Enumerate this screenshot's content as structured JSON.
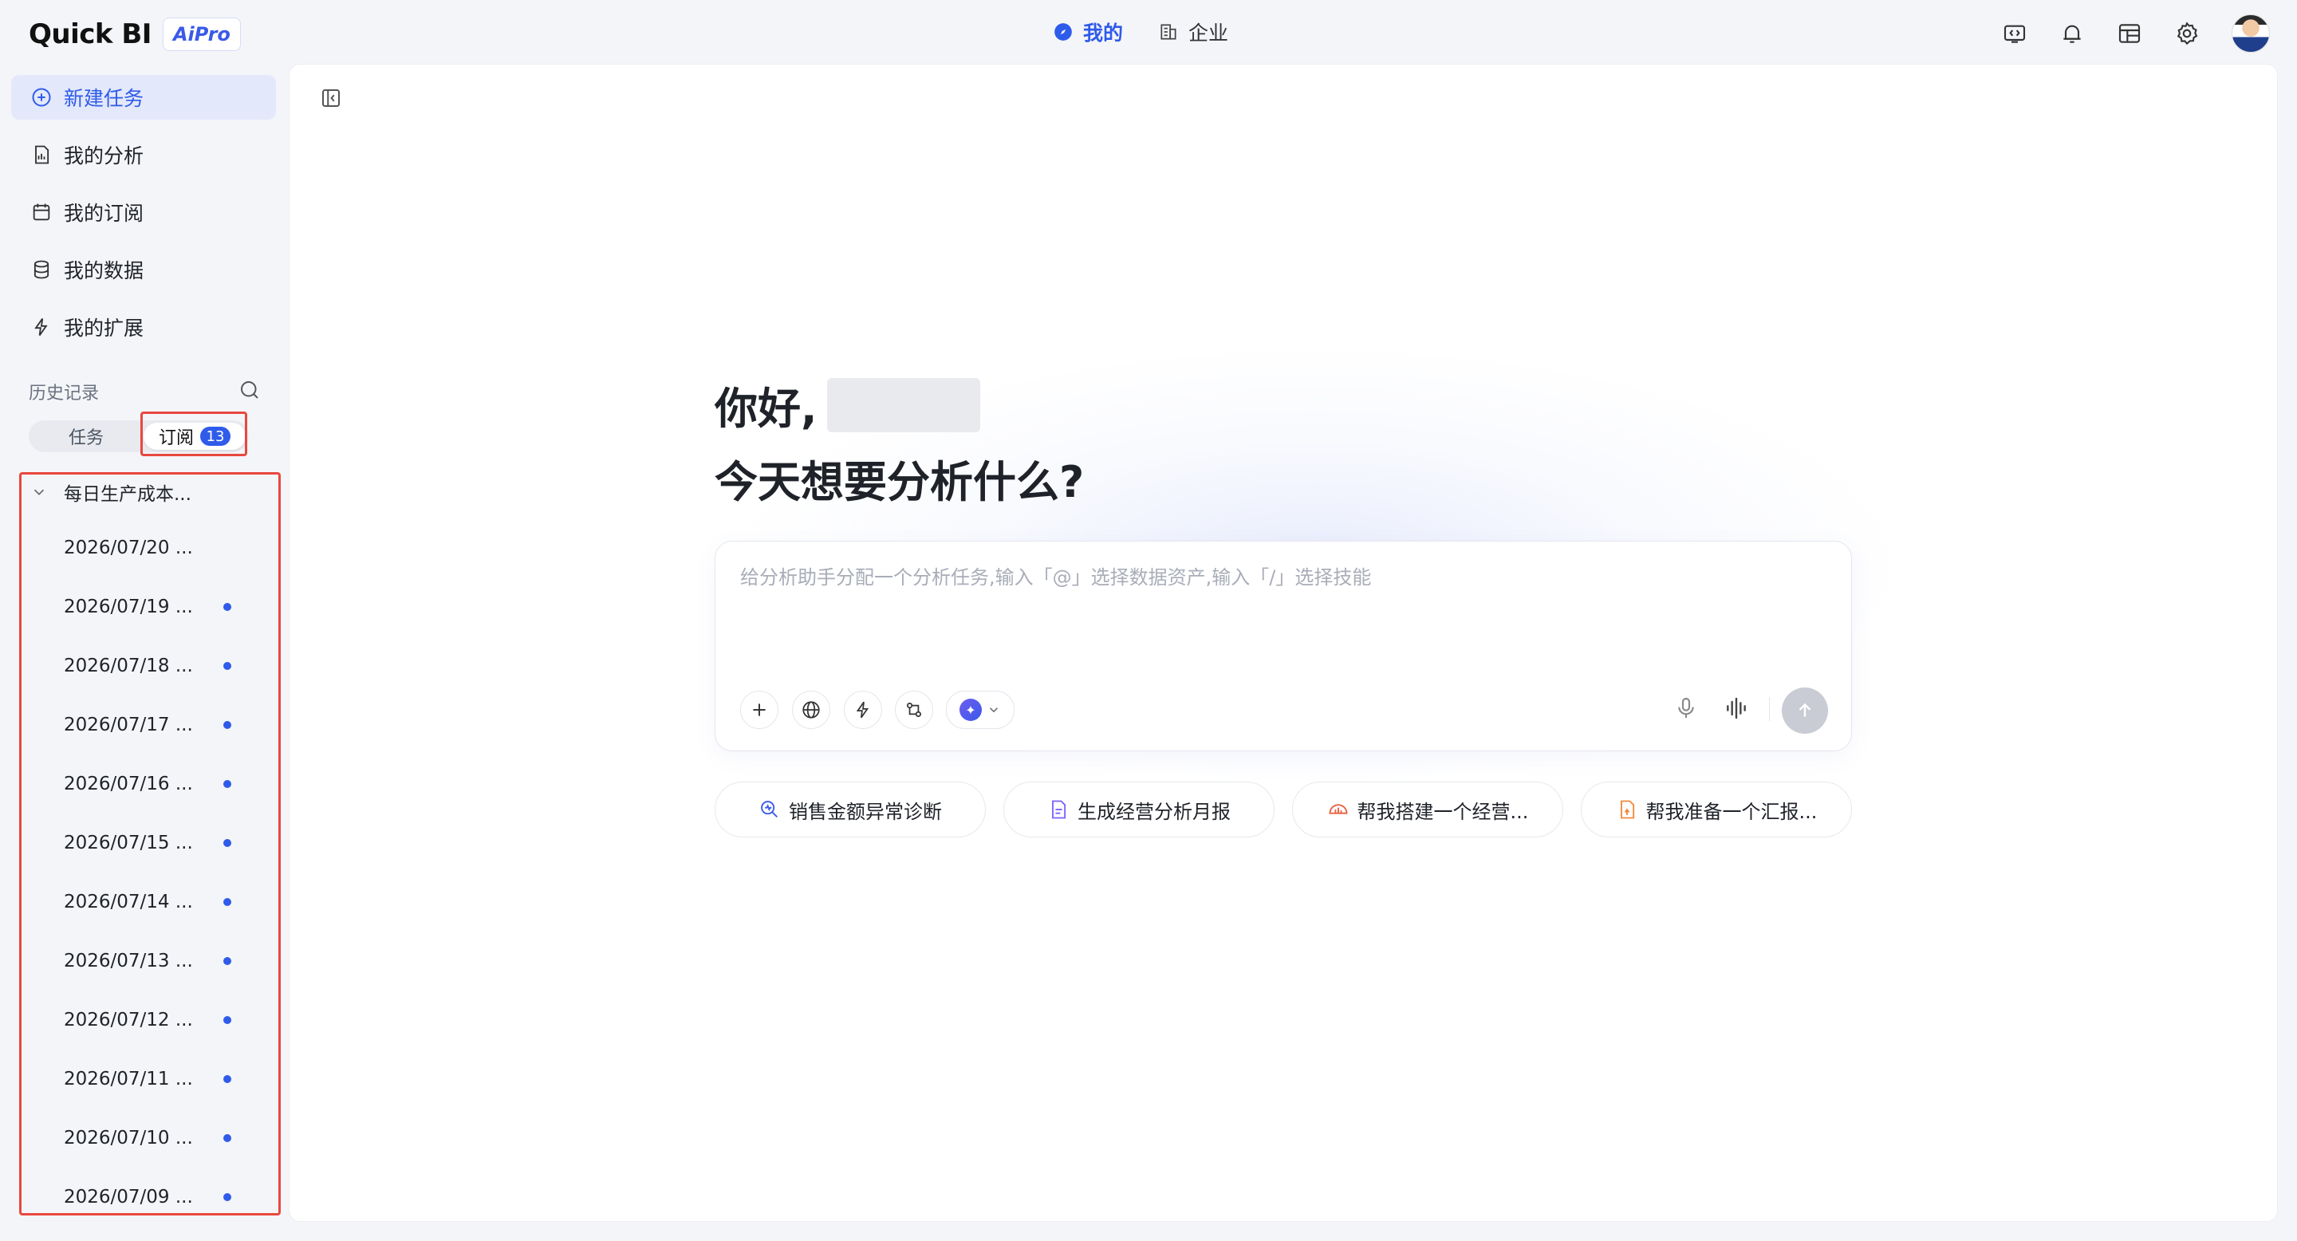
{
  "app": {
    "name": "Quick BI",
    "badge": "AiPro"
  },
  "topnav": [
    {
      "label": "我的",
      "icon": "compass-icon",
      "active": true
    },
    {
      "label": "企业",
      "icon": "building-icon",
      "active": false
    }
  ],
  "topright_icons": [
    "code-window-icon",
    "bell-icon",
    "dashboard-icon",
    "gear-icon",
    "user-avatar"
  ],
  "sidebar": {
    "items": [
      {
        "label": "新建任务",
        "icon": "plus-circle-icon",
        "active": true
      },
      {
        "label": "我的分析",
        "icon": "report-file-icon",
        "active": false
      },
      {
        "label": "我的订阅",
        "icon": "calendar-icon",
        "active": false
      },
      {
        "label": "我的数据",
        "icon": "database-icon",
        "active": false
      },
      {
        "label": "我的扩展",
        "icon": "lightning-icon",
        "active": false
      }
    ],
    "history_label": "历史记录",
    "tabs": {
      "task": "任务",
      "subscription": "订阅",
      "subscription_count": "13"
    },
    "group_title": "每日生产成本...",
    "subscriptions": [
      {
        "label": "2026/07/20 ...",
        "unread": false
      },
      {
        "label": "2026/07/19 ...",
        "unread": true
      },
      {
        "label": "2026/07/18 ...",
        "unread": true
      },
      {
        "label": "2026/07/17 ...",
        "unread": true
      },
      {
        "label": "2026/07/16 ...",
        "unread": true
      },
      {
        "label": "2026/07/15 ...",
        "unread": true
      },
      {
        "label": "2026/07/14 ...",
        "unread": true
      },
      {
        "label": "2026/07/13 ...",
        "unread": true
      },
      {
        "label": "2026/07/12 ...",
        "unread": true
      },
      {
        "label": "2026/07/11 ...",
        "unread": true
      },
      {
        "label": "2026/07/10 ...",
        "unread": true
      },
      {
        "label": "2026/07/09 ...",
        "unread": true
      }
    ]
  },
  "main": {
    "greeting": "你好,",
    "question": "今天想要分析什么?",
    "input_placeholder": "给分析助手分配一个分析任务,输入「@」选择数据资产,输入「/」选择技能",
    "suggestions": [
      {
        "label": "销售金额异常诊断",
        "icon": "diagnose-icon",
        "color": "#3a5ae8"
      },
      {
        "label": "生成经营分析月报",
        "icon": "document-icon",
        "color": "#7b61ff"
      },
      {
        "label": "帮我搭建一个经营...",
        "icon": "dashboard-build-icon",
        "color": "#e8603f"
      },
      {
        "label": "帮我准备一个汇报...",
        "icon": "report-icon",
        "color": "#f08a3c"
      }
    ]
  },
  "colors": {
    "accent": "#2f5bea",
    "highlight_box": "#e8483f"
  }
}
